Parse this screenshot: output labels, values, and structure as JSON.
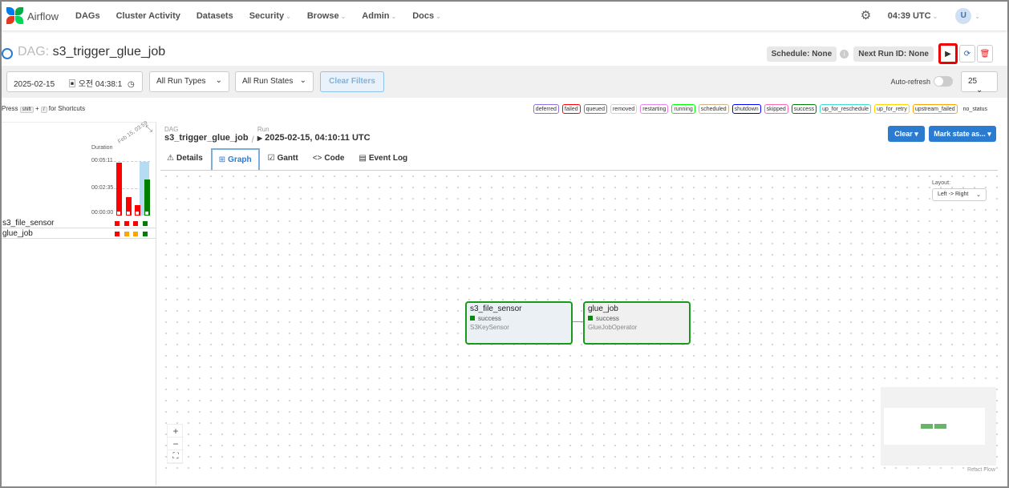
{
  "nav": {
    "logo_text": "Airflow",
    "items": [
      {
        "label": "DAGs",
        "caret": false
      },
      {
        "label": "Cluster Activity",
        "caret": false
      },
      {
        "label": "Datasets",
        "caret": false
      },
      {
        "label": "Security",
        "caret": true
      },
      {
        "label": "Browse",
        "caret": true
      },
      {
        "label": "Admin",
        "caret": true
      },
      {
        "label": "Docs",
        "caret": true
      }
    ],
    "time": "04:39 UTC",
    "avatar": "U"
  },
  "dag": {
    "prefix": "DAG:",
    "name": "s3_trigger_glue_job",
    "schedule": "Schedule: None",
    "next_run": "Next Run ID: None"
  },
  "filters": {
    "date": "2025-02-15",
    "time": "오전 04:38:1",
    "run_types": "All Run Types",
    "run_states": "All Run States",
    "clear": "Clear Filters",
    "autorefresh": "Auto-refresh",
    "num_runs": "25"
  },
  "shortcuts": {
    "press": "Press",
    "key1": "shift",
    "plus": "+",
    "key2": "/",
    "suffix": "for Shortcuts"
  },
  "legend": [
    {
      "label": "deferred",
      "color": "#9370db"
    },
    {
      "label": "failed",
      "color": "#ff0000"
    },
    {
      "label": "queued",
      "color": "#808080"
    },
    {
      "label": "removed",
      "color": "#d3d3d3"
    },
    {
      "label": "restarting",
      "color": "#ee82ee"
    },
    {
      "label": "running",
      "color": "#00ff00"
    },
    {
      "label": "scheduled",
      "color": "#d2b48c"
    },
    {
      "label": "shutdown",
      "color": "#0000ff"
    },
    {
      "label": "skipped",
      "color": "#ff69b4"
    },
    {
      "label": "success",
      "color": "#008000"
    },
    {
      "label": "up_for_reschedule",
      "color": "#40e0d0"
    },
    {
      "label": "up_for_retry",
      "color": "#ffd700"
    },
    {
      "label": "upstream_failed",
      "color": "#ffa500"
    },
    {
      "label": "no_status",
      "color": "#ffffff"
    }
  ],
  "grid": {
    "duration_label": "Duration",
    "date_label": "Feb 15, 03:59",
    "y_ticks": [
      "00:05:11",
      "00:02:35",
      "00:00:00"
    ],
    "run_durations_sec": [
      311,
      110,
      60,
      210
    ],
    "run_colors": [
      "#ff0000",
      "#ff0000",
      "#ff0000",
      "#008000"
    ],
    "tasks": [
      {
        "name": "s3_file_sensor",
        "states": [
          "#ff0000",
          "#ff0000",
          "#ff0000",
          "#008000"
        ]
      },
      {
        "name": "glue_job",
        "states": [
          "#ff0000",
          "#ffa500",
          "#ffa500",
          "#008000"
        ]
      }
    ]
  },
  "breadcrumb": {
    "dag_label": "DAG",
    "dag_value": "s3_trigger_glue_job",
    "run_label": "Run",
    "run_value": "2025-02-15, 04:10:11 UTC"
  },
  "actions": {
    "clear": "Clear",
    "mark": "Mark state as..."
  },
  "tabs": [
    {
      "label": "Details",
      "icon": "⚠"
    },
    {
      "label": "Graph",
      "icon": "⊞"
    },
    {
      "label": "Gantt",
      "icon": "☑"
    },
    {
      "label": "Code",
      "icon": "<>"
    },
    {
      "label": "Event Log",
      "icon": "▤"
    }
  ],
  "graph": {
    "layout_label": "Layout:",
    "layout_value": "Left -> Right",
    "nodes": [
      {
        "name": "s3_file_sensor",
        "state": "success",
        "operator": "S3KeySensor"
      },
      {
        "name": "glue_job",
        "state": "success",
        "operator": "GlueJobOperator"
      }
    ],
    "attribution": "React Flow"
  }
}
